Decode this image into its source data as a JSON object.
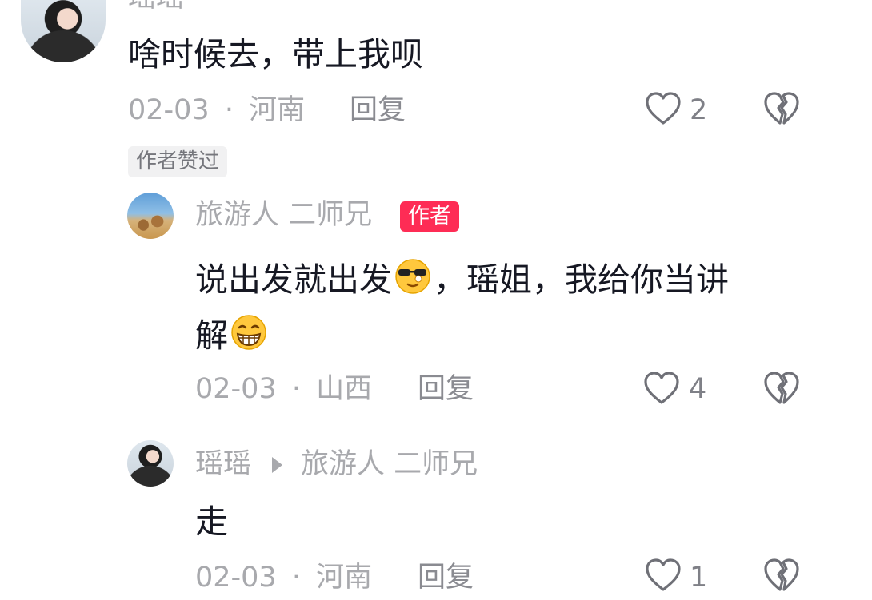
{
  "comment1": {
    "username": "瑶瑶",
    "text": "啥时候去，带上我呗",
    "date": "02-03",
    "separator": "·",
    "location": "河南",
    "reply_label": "回复",
    "like_count": "2",
    "author_liked_badge": "作者赞过"
  },
  "reply1": {
    "username": "旅游人 二师兄",
    "author_badge": "作者",
    "text_line1_part1": "说出发就出发",
    "text_line1_part2": "，瑶姐，我给你当讲",
    "text_line2": "解",
    "date": "02-03",
    "separator": "·",
    "location": "山西",
    "reply_label": "回复",
    "like_count": "4"
  },
  "reply2": {
    "username": "瑶瑶",
    "reply_to": "旅游人 二师兄",
    "text": "走",
    "date": "02-03",
    "separator": "·",
    "location": "河南",
    "reply_label": "回复",
    "like_count": "1"
  },
  "icons": {
    "like": "heart-outline-icon",
    "dislike": "broken-heart-icon",
    "reply_arrow": "triangle-right-icon",
    "emoji_sunglasses": "sunglasses-face-emoji",
    "emoji_grin": "grinning-face-emoji"
  },
  "colors": {
    "author_badge": "#fe2c55",
    "text": "#161823",
    "muted": "#a8a9ad"
  }
}
